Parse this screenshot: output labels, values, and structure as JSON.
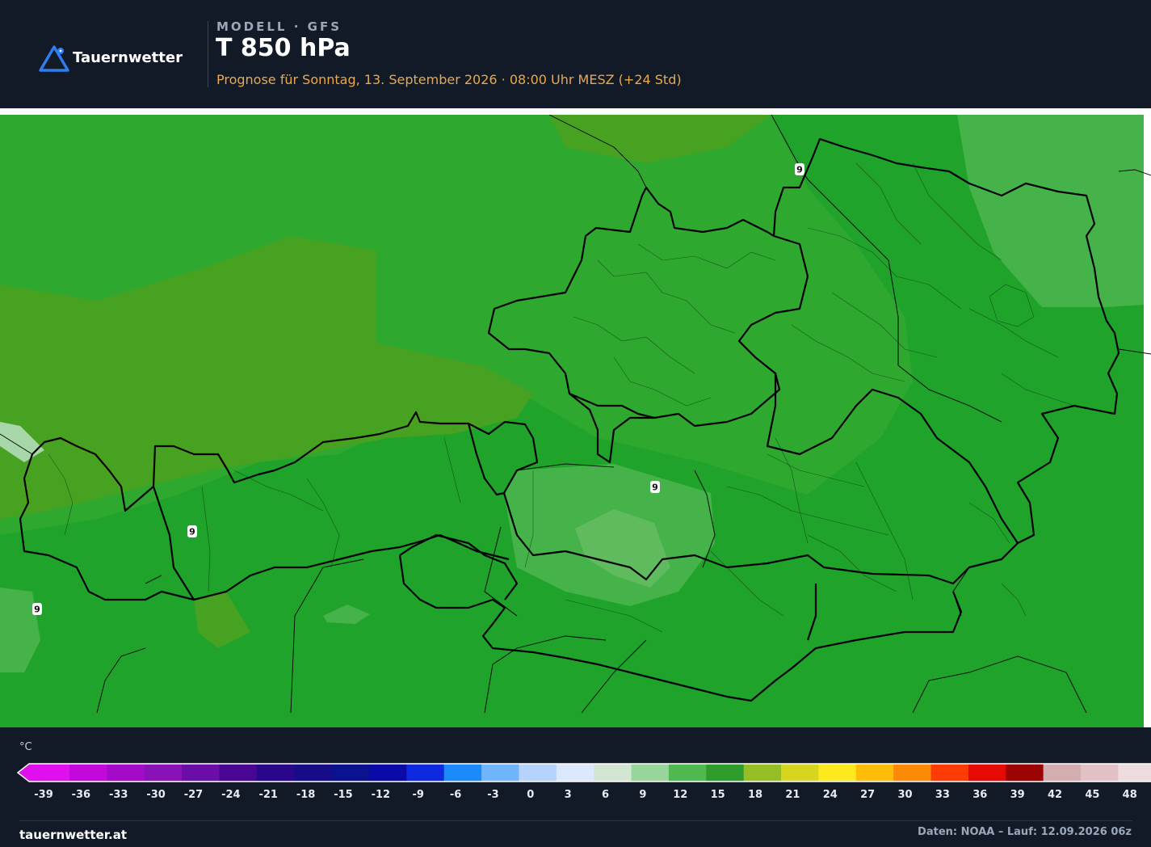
{
  "header": {
    "brand": "Tauernwetter",
    "kicker": "MODELL · GFS",
    "title": "T 850 hPa",
    "subtitle": "Prognose für Sonntag, 13. September 2026 · 08:00 Uhr MESZ  (+24 Std)"
  },
  "map": {
    "fill_colors": {
      "base": "#1fa32b",
      "band_9_12": "#2fa830",
      "band_12_15": "#48a221",
      "band_6_9": "#45b34a",
      "band_3_6": "#5fbb5d",
      "band_0_3": "#a7d6a8"
    },
    "border_color": "#000000",
    "isoline_labels": [
      "9",
      "9",
      "9",
      "9"
    ]
  },
  "legend": {
    "unit": "°C",
    "ticks": [
      "-39",
      "-36",
      "-33",
      "-30",
      "-27",
      "-24",
      "-21",
      "-18",
      "-15",
      "-12",
      "-9",
      "-6",
      "-3",
      "0",
      "3",
      "6",
      "9",
      "12",
      "15",
      "18",
      "21",
      "24",
      "27",
      "30",
      "33",
      "36",
      "39",
      "42",
      "45",
      "48"
    ],
    "colors": [
      "#e010ee",
      "#c308dc",
      "#a40bc8",
      "#8812b5",
      "#6a0ea7",
      "#4a0794",
      "#29068a",
      "#170b88",
      "#0a1290",
      "#0a0aa6",
      "#0d2ae0",
      "#1c8afa",
      "#70b4fb",
      "#b5d3fc",
      "#dbe8fd",
      "#d2e6d3",
      "#98d59b",
      "#4fb94f",
      "#2e9c2b",
      "#95bd24",
      "#d7d51f",
      "#fde71d",
      "#fdbd09",
      "#fd8a06",
      "#fd3c05",
      "#e60a05",
      "#9c0404",
      "#d3adb0",
      "#e2c1c6",
      "#ecdcde",
      "#f6eef0"
    ]
  },
  "footer": {
    "site": "tauernwetter.at",
    "source": "Daten: NOAA – Lauf: 12.09.2026 06z"
  }
}
